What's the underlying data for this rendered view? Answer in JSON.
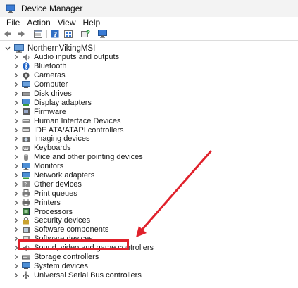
{
  "window": {
    "title": "Device Manager"
  },
  "menu": [
    "File",
    "Action",
    "View",
    "Help"
  ],
  "toolbar": {
    "icons": [
      "back-arrow-icon",
      "forward-arrow-icon",
      "properties-icon",
      "list-icon",
      "help-icon",
      "details-icon",
      "update-driver-icon",
      "monitor-icon"
    ]
  },
  "tree": {
    "root": "NorthernVikingMSI",
    "categories": [
      "Audio inputs and outputs",
      "Bluetooth",
      "Cameras",
      "Computer",
      "Disk drives",
      "Display adapters",
      "Firmware",
      "Human Interface Devices",
      "IDE ATA/ATAPI controllers",
      "Imaging devices",
      "Keyboards",
      "Mice and other pointing devices",
      "Monitors",
      "Network adapters",
      "Other devices",
      "Print queues",
      "Printers",
      "Processors",
      "Security devices",
      "Software components",
      "Software devices",
      "Sound, video and game controllers",
      "Storage controllers",
      "System devices",
      "Universal Serial Bus controllers"
    ],
    "highlighted": "Sound, video and game controllers"
  },
  "colors": {
    "annotation": "#e0212b"
  }
}
